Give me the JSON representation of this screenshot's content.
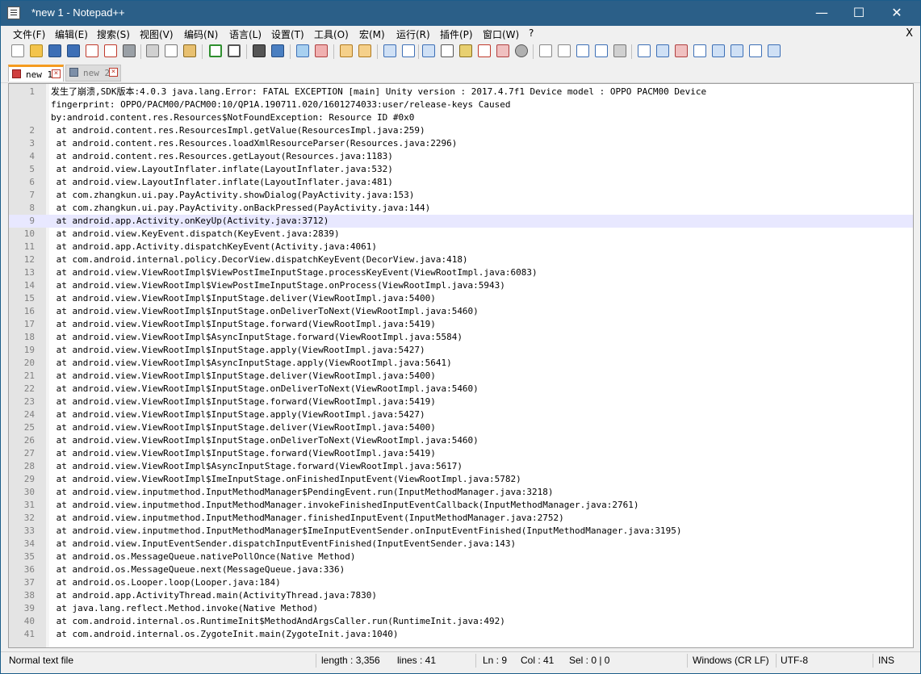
{
  "window": {
    "title": "*new 1 - Notepad++",
    "minimize": "—",
    "maximize": "☐",
    "close": "✕"
  },
  "menu": [
    {
      "label": "文件(F)"
    },
    {
      "label": "编辑(E)"
    },
    {
      "label": "搜索(S)"
    },
    {
      "label": "视图(V)"
    },
    {
      "label": "编码(N)"
    },
    {
      "label": "语言(L)"
    },
    {
      "label": "设置(T)"
    },
    {
      "label": "工具(O)"
    },
    {
      "label": "宏(M)"
    },
    {
      "label": "运行(R)"
    },
    {
      "label": "插件(P)"
    },
    {
      "label": "窗口(W)"
    },
    {
      "label": "?"
    }
  ],
  "menu_close": "X",
  "tabs": [
    {
      "label": "new 1",
      "close": "×"
    },
    {
      "label": "new 2",
      "close": "×"
    }
  ],
  "editor": {
    "current_line": 9,
    "lines": [
      {
        "n": "1",
        "text": "发生了崩溃,SDK版本:4.0.3 java.lang.Error: FATAL EXCEPTION [main] Unity version : 2017.4.7f1 Device model : OPPO PACM00 Device"
      },
      {
        "n": "",
        "text": "fingerprint: OPPO/PACM00/PACM00:10/QP1A.190711.020/1601274033:user/release-keys Caused"
      },
      {
        "n": "",
        "text": "by:android.content.res.Resources$NotFoundException: Resource ID #0x0"
      },
      {
        "n": "2",
        "text": " at android.content.res.ResourcesImpl.getValue(ResourcesImpl.java:259)"
      },
      {
        "n": "3",
        "text": " at android.content.res.Resources.loadXmlResourceParser(Resources.java:2296)"
      },
      {
        "n": "4",
        "text": " at android.content.res.Resources.getLayout(Resources.java:1183)"
      },
      {
        "n": "5",
        "text": " at android.view.LayoutInflater.inflate(LayoutInflater.java:532)"
      },
      {
        "n": "6",
        "text": " at android.view.LayoutInflater.inflate(LayoutInflater.java:481)"
      },
      {
        "n": "7",
        "text": " at com.zhangkun.ui.pay.PayActivity.showDialog(PayActivity.java:153)"
      },
      {
        "n": "8",
        "text": " at com.zhangkun.ui.pay.PayActivity.onBackPressed(PayActivity.java:144)"
      },
      {
        "n": "9",
        "text": " at android.app.Activity.onKeyUp(Activity.java:3712)"
      },
      {
        "n": "10",
        "text": " at android.view.KeyEvent.dispatch(KeyEvent.java:2839)"
      },
      {
        "n": "11",
        "text": " at android.app.Activity.dispatchKeyEvent(Activity.java:4061)"
      },
      {
        "n": "12",
        "text": " at com.android.internal.policy.DecorView.dispatchKeyEvent(DecorView.java:418)"
      },
      {
        "n": "13",
        "text": " at android.view.ViewRootImpl$ViewPostImeInputStage.processKeyEvent(ViewRootImpl.java:6083)"
      },
      {
        "n": "14",
        "text": " at android.view.ViewRootImpl$ViewPostImeInputStage.onProcess(ViewRootImpl.java:5943)"
      },
      {
        "n": "15",
        "text": " at android.view.ViewRootImpl$InputStage.deliver(ViewRootImpl.java:5400)"
      },
      {
        "n": "16",
        "text": " at android.view.ViewRootImpl$InputStage.onDeliverToNext(ViewRootImpl.java:5460)"
      },
      {
        "n": "17",
        "text": " at android.view.ViewRootImpl$InputStage.forward(ViewRootImpl.java:5419)"
      },
      {
        "n": "18",
        "text": " at android.view.ViewRootImpl$AsyncInputStage.forward(ViewRootImpl.java:5584)"
      },
      {
        "n": "19",
        "text": " at android.view.ViewRootImpl$InputStage.apply(ViewRootImpl.java:5427)"
      },
      {
        "n": "20",
        "text": " at android.view.ViewRootImpl$AsyncInputStage.apply(ViewRootImpl.java:5641)"
      },
      {
        "n": "21",
        "text": " at android.view.ViewRootImpl$InputStage.deliver(ViewRootImpl.java:5400)"
      },
      {
        "n": "22",
        "text": " at android.view.ViewRootImpl$InputStage.onDeliverToNext(ViewRootImpl.java:5460)"
      },
      {
        "n": "23",
        "text": " at android.view.ViewRootImpl$InputStage.forward(ViewRootImpl.java:5419)"
      },
      {
        "n": "24",
        "text": " at android.view.ViewRootImpl$InputStage.apply(ViewRootImpl.java:5427)"
      },
      {
        "n": "25",
        "text": " at android.view.ViewRootImpl$InputStage.deliver(ViewRootImpl.java:5400)"
      },
      {
        "n": "26",
        "text": " at android.view.ViewRootImpl$InputStage.onDeliverToNext(ViewRootImpl.java:5460)"
      },
      {
        "n": "27",
        "text": " at android.view.ViewRootImpl$InputStage.forward(ViewRootImpl.java:5419)"
      },
      {
        "n": "28",
        "text": " at android.view.ViewRootImpl$AsyncInputStage.forward(ViewRootImpl.java:5617)"
      },
      {
        "n": "29",
        "text": " at android.view.ViewRootImpl$ImeInputStage.onFinishedInputEvent(ViewRootImpl.java:5782)"
      },
      {
        "n": "30",
        "text": " at android.view.inputmethod.InputMethodManager$PendingEvent.run(InputMethodManager.java:3218)"
      },
      {
        "n": "31",
        "text": " at android.view.inputmethod.InputMethodManager.invokeFinishedInputEventCallback(InputMethodManager.java:2761)"
      },
      {
        "n": "32",
        "text": " at android.view.inputmethod.InputMethodManager.finishedInputEvent(InputMethodManager.java:2752)"
      },
      {
        "n": "33",
        "text": " at android.view.inputmethod.InputMethodManager$ImeInputEventSender.onInputEventFinished(InputMethodManager.java:3195)"
      },
      {
        "n": "34",
        "text": " at android.view.InputEventSender.dispatchInputEventFinished(InputEventSender.java:143)"
      },
      {
        "n": "35",
        "text": " at android.os.MessageQueue.nativePollOnce(Native Method)"
      },
      {
        "n": "36",
        "text": " at android.os.MessageQueue.next(MessageQueue.java:336)"
      },
      {
        "n": "37",
        "text": " at android.os.Looper.loop(Looper.java:184)"
      },
      {
        "n": "38",
        "text": " at android.app.ActivityThread.main(ActivityThread.java:7830)"
      },
      {
        "n": "39",
        "text": " at java.lang.reflect.Method.invoke(Native Method)"
      },
      {
        "n": "40",
        "text": " at com.android.internal.os.RuntimeInit$MethodAndArgsCaller.run(RuntimeInit.java:492)"
      },
      {
        "n": "41",
        "text": " at com.android.internal.os.ZygoteInit.main(ZygoteInit.java:1040)"
      }
    ]
  },
  "status": {
    "file_type": "Normal text file",
    "length": "length : 3,356",
    "lines": "lines : 41",
    "ln": "Ln : 9",
    "col": "Col : 41",
    "sel": "Sel : 0 | 0",
    "eol": "Windows (CR LF)",
    "encoding": "UTF-8",
    "mode": "INS"
  }
}
